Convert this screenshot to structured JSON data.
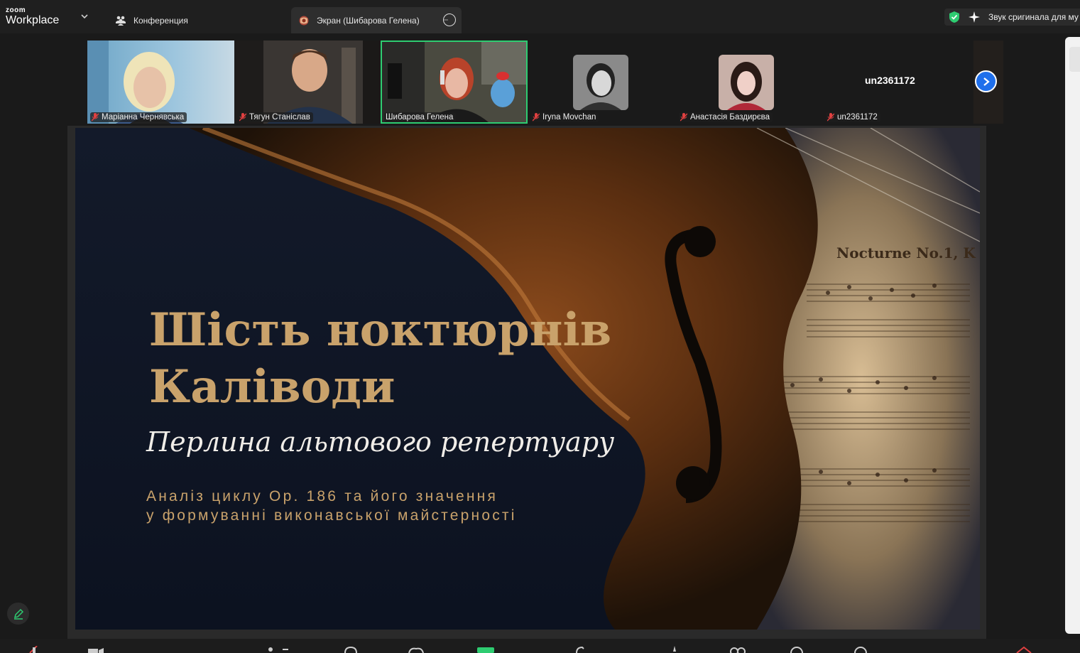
{
  "app": {
    "brand_small": "zoom",
    "brand_big": "Workplace"
  },
  "tabs": [
    {
      "label": "Конференция",
      "icon": "people-icon"
    },
    {
      "label": "Экран (Шибарова Гелена)",
      "icon": "screen-share-icon"
    }
  ],
  "notice": {
    "label": "Звук сригинала для му"
  },
  "participants": [
    {
      "name": "Маріанна Чернявська",
      "muted": true
    },
    {
      "name": "Тягун Станіслав",
      "muted": true
    },
    {
      "name": "Шибарова Гелена",
      "muted": false
    },
    {
      "name": "Iryna Movchan",
      "muted": true
    },
    {
      "name": "Анастасія Баздирєва",
      "muted": true
    },
    {
      "name": "un2361172",
      "muted": true
    }
  ],
  "featured_name": "un2361172",
  "slide": {
    "title_line1": "Шість ноктюрнів",
    "title_line2": "Каліводи",
    "subtitle": "Перлина альтового репертуару",
    "desc_line1": "Аналіз циклу Ор. 186 та його значення",
    "desc_line2": "у формуванні виконавської майстерності",
    "sheet_title": "Nocturne No.1, K",
    "colors": {
      "gold": "#c9a26b",
      "background": "#101726",
      "wood": "#6b3b17"
    }
  },
  "colors": {
    "active_speaker": "#2ecc71",
    "accent_blue": "#1f6feb",
    "mute_red": "#e04040"
  }
}
